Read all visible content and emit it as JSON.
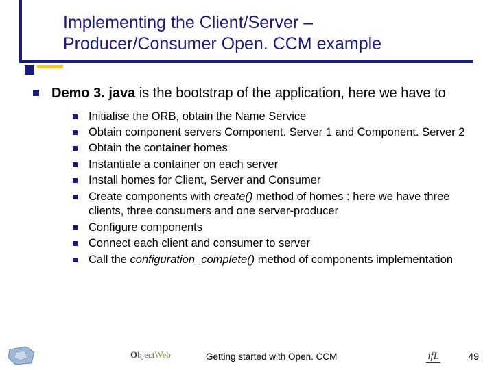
{
  "title_line1": "Implementing the Client/Server –",
  "title_line2": "Producer/Consumer Open. CCM example",
  "body": {
    "lead_bold": "Demo 3. java",
    "lead_rest": " is the bootstrap of the application, here we have to",
    "items": [
      {
        "text": "Initialise the ORB, obtain the Name Service"
      },
      {
        "text": "Obtain component servers Component. Server 1 and Component. Server 2"
      },
      {
        "text": "Obtain the container homes"
      },
      {
        "text": "Instantiate a container on each server"
      },
      {
        "text": "Install homes for Client, Server and Consumer"
      },
      {
        "pre": "Create components with ",
        "em": "create()",
        "post": " method of homes : here we have three clients, three consumers and one server-producer"
      },
      {
        "text": "Configure components"
      },
      {
        "text": "Connect each client and consumer to server"
      },
      {
        "pre": "Call the ",
        "em": "configuration_complete()",
        "post": " method of components implementation"
      }
    ]
  },
  "footer": {
    "center_logo": "ObjectWeb",
    "text": "Getting started with Open. CCM",
    "right_logo": "ifL",
    "page": "49"
  }
}
